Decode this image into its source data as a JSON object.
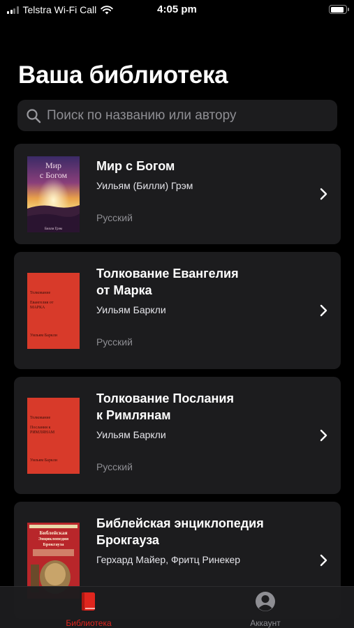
{
  "status_bar": {
    "carrier": "Telstra Wi-Fi Call",
    "time": "4:05 pm",
    "battery_level": 0.92
  },
  "page": {
    "title": "Ваша библиотека"
  },
  "search": {
    "placeholder": "Поиск по названию или автору",
    "icon": "search-icon"
  },
  "books": [
    {
      "title_line1": "Мир с Богом",
      "title_line2": "",
      "author": "Уильям (Билли) Грэм",
      "language": "Русский",
      "cover_text": [
        "Мир",
        "с Богом",
        "Билли Грэм"
      ]
    },
    {
      "title_line1": "Толкование Евангелия",
      "title_line2": "от Марка",
      "author": "Уильям Баркли",
      "language": "Русский",
      "cover_text": [
        "Толкование",
        "Евангелия от",
        "МАРКА",
        "Уильям Баркли"
      ]
    },
    {
      "title_line1": "Толкование Послания",
      "title_line2": "к Римлянам",
      "author": "Уильям Баркли",
      "language": "Русский",
      "cover_text": [
        "Толкование",
        "Послания к",
        "РИМЛЯНАМ",
        "Уильям Баркли"
      ]
    },
    {
      "title_line1": "Библейская энциклопедия",
      "title_line2": "Брокгауза",
      "author": "Герхард Майер, Фритц Ринекер",
      "language": "",
      "cover_text": [
        "Библейская",
        "Энциклопедия",
        "Брокгауза"
      ]
    }
  ],
  "tab_bar": {
    "library": {
      "label": "Библиотека",
      "icon": "book-icon",
      "active": true
    },
    "account": {
      "label": "Аккаунт",
      "icon": "person-circle-icon",
      "active": false
    }
  },
  "colors": {
    "background": "#000000",
    "card": "#1c1c1e",
    "accent": "#e0261e",
    "secondary_text": "#8e8e93"
  }
}
